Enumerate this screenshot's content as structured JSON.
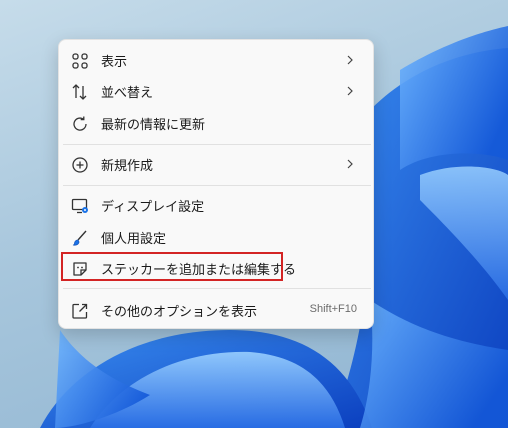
{
  "desktop": {
    "background_color": "#a7c6dc",
    "wallpaper_accent": "#1a73e8"
  },
  "context_menu": {
    "items": [
      {
        "label": "表示",
        "icon": "view-grid-icon",
        "submenu": true
      },
      {
        "label": "並べ替え",
        "icon": "sort-icon",
        "submenu": true
      },
      {
        "label": "最新の情報に更新",
        "icon": "refresh-icon",
        "submenu": false
      },
      {
        "label": "新規作成",
        "icon": "new-plus-icon",
        "submenu": true
      },
      {
        "label": "ディスプレイ設定",
        "icon": "display-settings-icon",
        "submenu": false
      },
      {
        "label": "個人用設定",
        "icon": "personalize-brush-icon",
        "submenu": false
      },
      {
        "label": "ステッカーを追加または編集する",
        "icon": "sticker-icon",
        "submenu": false,
        "highlighted": true
      },
      {
        "label": "その他のオプションを表示",
        "icon": "more-options-icon",
        "submenu": false,
        "shortcut": "Shift+F10"
      }
    ],
    "highlight_color": "#d32424"
  }
}
